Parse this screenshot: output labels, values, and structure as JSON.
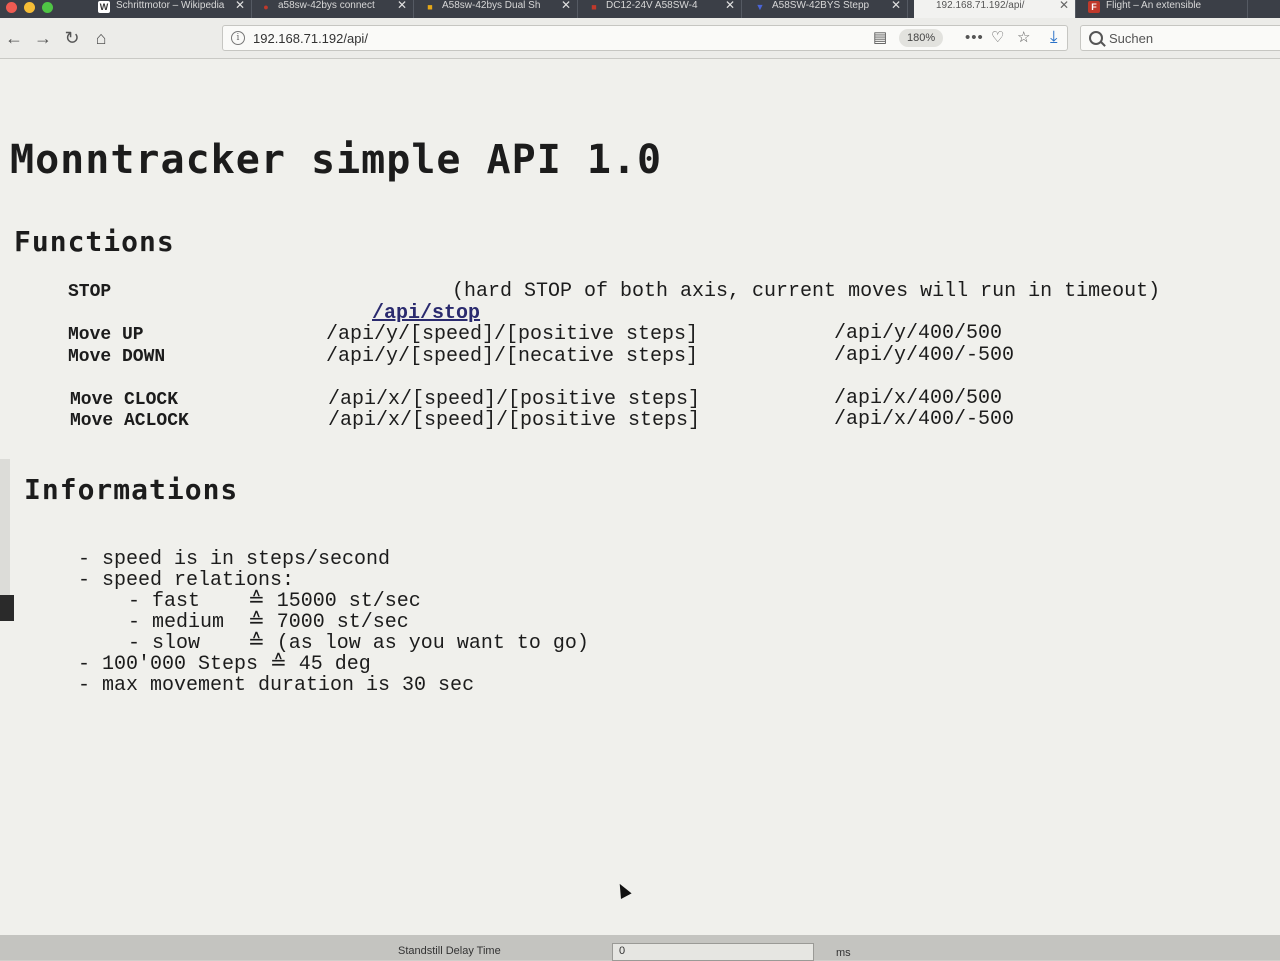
{
  "tabs": [
    {
      "title": "Schrittmotor – Wikipedia",
      "favicon": "W",
      "favicon_color": "#555555"
    },
    {
      "title": "a58sw-42bys connect",
      "favicon": "●",
      "favicon_color": "#c0392b"
    },
    {
      "title": "A58sw-42bys Dual Sh",
      "favicon": "■",
      "favicon_color": "#e6a817"
    },
    {
      "title": "DC12-24V A58SW-4",
      "favicon": "■",
      "favicon_color": "#c0392b"
    },
    {
      "title": "A58SW-42BYS Stepp",
      "favicon": "▼",
      "favicon_color": "#2b3f9e"
    },
    {
      "title": "192.168.71.192/api/",
      "favicon": "",
      "favicon_color": "#ffffff"
    },
    {
      "title": "Flight – An extensible",
      "favicon": "F",
      "favicon_color": "#c0392b"
    }
  ],
  "nav": {
    "back_icon": "←",
    "forward_icon": "→",
    "reload_icon": "↻",
    "home_icon": "⌂"
  },
  "urlbar": {
    "url": "192.168.71.192/api/",
    "zoom": "180%"
  },
  "search": {
    "placeholder": "Suchen"
  },
  "page": {
    "title": "Monntracker simple API 1.0",
    "functions_heading": "Functions",
    "stop": {
      "label": "STOP",
      "link": "/api/stop",
      "note": "(hard STOP of both axis, current moves will run in timeout)"
    },
    "moves": [
      {
        "label": "Move UP",
        "pattern": "/api/y/[speed]/[positive steps]",
        "example": "/api/y/400/500"
      },
      {
        "label": "Move DOWN",
        "pattern": "/api/y/[speed]/[necative steps]",
        "example": "/api/y/400/-500"
      },
      {
        "label": "Move CLOCK",
        "pattern": "/api/x/[speed]/[positive steps]",
        "example": "/api/x/400/500"
      },
      {
        "label": "Move ACLOCK",
        "pattern": "/api/x/[speed]/[positive steps]",
        "example": "/api/x/400/-500"
      }
    ],
    "informations_heading": "Informations",
    "info_lines": [
      "- speed is in steps/second",
      "- speed relations:",
      "  - fast    ≙ 15000 st/sec",
      "  - medium  ≙ 7000 st/sec",
      "  - slow    ≙ (as low as you want to go)",
      "- 100'000 Steps ≙ 45 deg",
      "- max movement duration is 30 sec"
    ]
  },
  "bottom": {
    "label": "Standstill Delay Time",
    "value": "0",
    "unit": "ms"
  }
}
